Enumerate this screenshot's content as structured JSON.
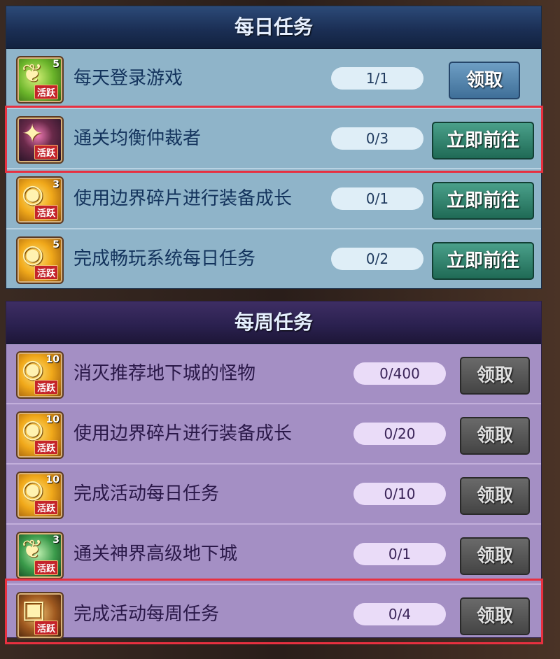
{
  "daily": {
    "title": "每日任务",
    "tasks": [
      {
        "name": "每天登录游戏",
        "progress": "1/1",
        "button": "领取",
        "icon": "green-leaf-icon",
        "count": "5",
        "tag": "活跃"
      },
      {
        "name": "通关均衡仲裁者",
        "progress": "0/3",
        "button": "立即前往",
        "icon": "dark-gem-icon",
        "count": "",
        "tag": "活跃"
      },
      {
        "name": "使用边界碎片进行装备成长",
        "progress": "0/1",
        "button": "立即前往",
        "icon": "gold-coin-icon",
        "count": "3",
        "tag": "活跃"
      },
      {
        "name": "完成畅玩系统每日任务",
        "progress": "0/2",
        "button": "立即前往",
        "icon": "gold-coin-icon",
        "count": "5",
        "tag": "活跃"
      }
    ]
  },
  "weekly": {
    "title": "每周任务",
    "tasks": [
      {
        "name": "消灭推荐地下城的怪物",
        "progress": "0/400",
        "button": "领取",
        "icon": "gold-coin-icon",
        "count": "10",
        "tag": "活跃"
      },
      {
        "name": "使用边界碎片进行装备成长",
        "progress": "0/20",
        "button": "领取",
        "icon": "gold-coin-icon",
        "count": "10",
        "tag": "活跃"
      },
      {
        "name": "完成活动每日任务",
        "progress": "0/10",
        "button": "领取",
        "icon": "gold-coin-icon",
        "count": "10",
        "tag": "活跃"
      },
      {
        "name": "通关神界高级地下城",
        "progress": "0/1",
        "button": "领取",
        "icon": "green-leaf-icon",
        "count": "3",
        "tag": "活跃"
      },
      {
        "name": "完成活动每周任务",
        "progress": "0/4",
        "button": "领取",
        "icon": "treasure-chest-icon",
        "count": "",
        "tag": "活跃"
      }
    ]
  },
  "colors": {
    "highlight": "#e83040",
    "daily_bg": "#8fb4c9",
    "weekly_bg": "#a48fc4"
  }
}
